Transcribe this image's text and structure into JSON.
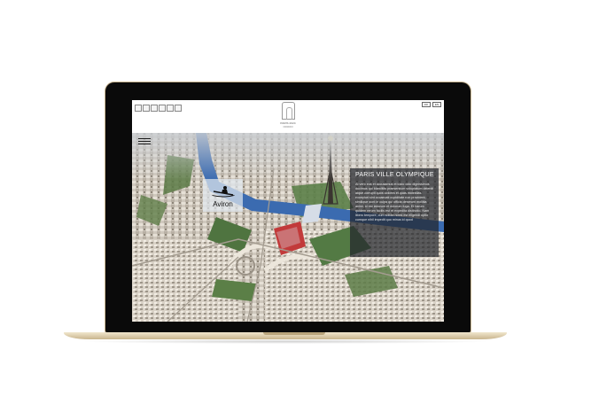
{
  "header": {
    "social_buttons": [
      "share-1",
      "share-2",
      "share-3",
      "share-4",
      "share-5",
      "share-6"
    ],
    "logo_text": "PARIS 2024",
    "logo_rings": "ooooo",
    "lang_buttons": [
      "FR",
      "EN"
    ]
  },
  "sport": {
    "label": "Aviron",
    "icon": "rowing-icon"
  },
  "info": {
    "title": "PARIS VILLE OLYMPIQUE",
    "body": "At vero eos et accusamus et iusto odio dignissimos ducimus qui blanditiis praesentium voluptatum deleniti atque corrupti quos dolores et quas molestias excepturi sint occaecati cupiditate non provident, similique sunt in culpa qui officia deserunt mollitia animi, id est laborum et dolorum fuga. Et harum quidem rerum facilis est et expedita distinctio. Nam libero tempore, cum soluta nobis est eligendi optio cumque nihil impedit quo minus id quod"
  },
  "colors": {
    "bezel": "#0a0a0a",
    "laptop_gold": "#d9c8a3",
    "panel": "#23262c",
    "river": "#3b6bb0",
    "stadium": "#c23a3a"
  }
}
